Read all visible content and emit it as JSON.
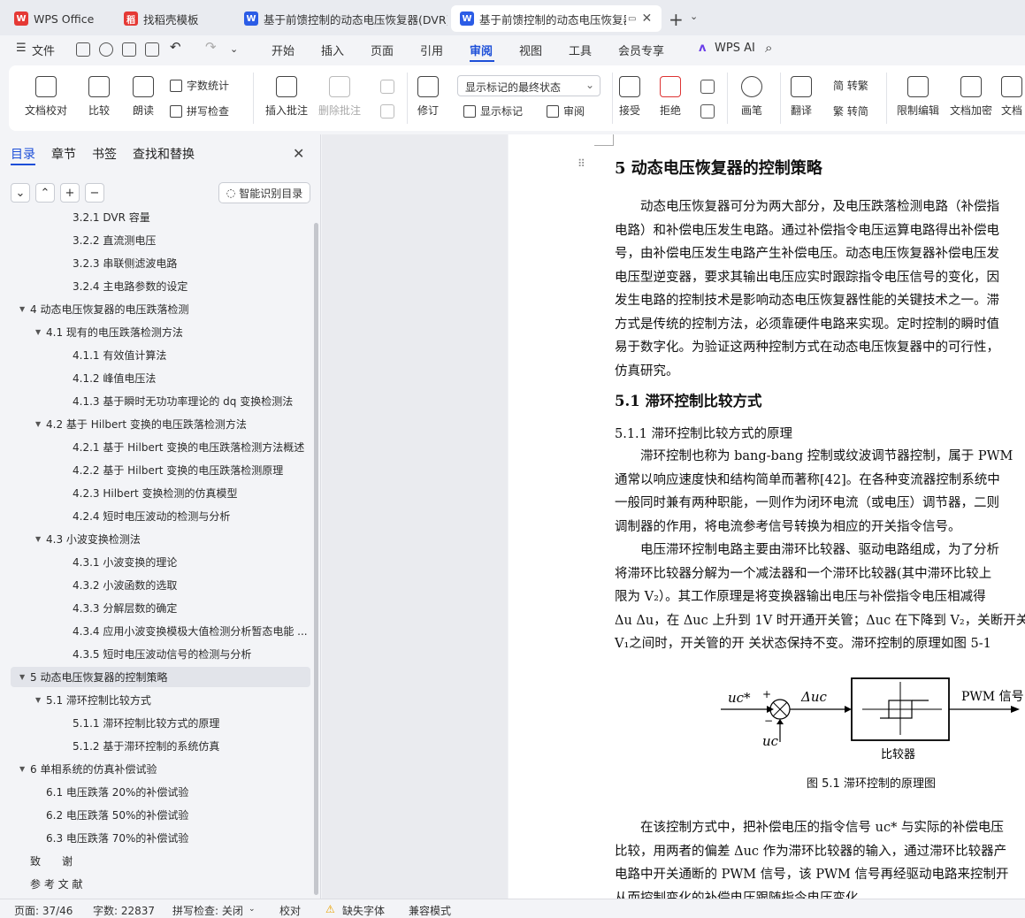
{
  "tabs": [
    {
      "label": "WPS Office",
      "icon": "wps-logo-icon",
      "color": "#e53935"
    },
    {
      "label": "找稻壳模板",
      "icon": "docer-icon",
      "color": "#e53935"
    },
    {
      "label": "基于前馈控制的动态电压恢复器(DVR)",
      "icon": "word-doc-icon",
      "color": "#2b5ce6"
    },
    {
      "label": "基于前馈控制的动态电压恢复器",
      "icon": "word-doc-icon",
      "color": "#2b5ce6"
    }
  ],
  "menu": {
    "file": "文件",
    "items": [
      "开始",
      "插入",
      "页面",
      "引用",
      "审阅",
      "视图",
      "工具",
      "会员专享"
    ],
    "active": "审阅",
    "wps_ai": "WPS AI"
  },
  "ribbon": {
    "doc_check": "文档校对",
    "compare": "比较",
    "read_aloud": "朗读",
    "word_count": "字数统计",
    "spell_check": "拼写检查",
    "insert_comment": "插入批注",
    "delete_comment": "删除批注",
    "track": "修订",
    "display_state": "显示标记的最终状态",
    "show_markup": "显示标记",
    "review": "审阅",
    "accept": "接受",
    "reject": "拒绝",
    "pen": "画笔",
    "translate": "翻译",
    "to_trad": "简 转繁",
    "to_simp": "繁 转简",
    "restrict_edit": "限制编辑",
    "encrypt": "文档加密",
    "doc_more": "文档"
  },
  "nav": {
    "tabs": [
      "目录",
      "章节",
      "书签",
      "查找和替换"
    ],
    "active_tab": "目录",
    "smart_toc": "智能识别目录",
    "items": [
      {
        "text": "3.2.1 DVR 容量",
        "level": 3,
        "arrow": ""
      },
      {
        "text": "3.2.2 直流测电压",
        "level": 3,
        "arrow": ""
      },
      {
        "text": "3.2.3 串联侧滤波电路",
        "level": 3,
        "arrow": ""
      },
      {
        "text": "3.2.4 主电路参数的设定",
        "level": 3,
        "arrow": ""
      },
      {
        "text": "4 动态电压恢复器的电压跌落检测",
        "level": 1,
        "arrow": "▼"
      },
      {
        "text": "4.1 现有的电压跌落检测方法",
        "level": 2,
        "arrow": "▼"
      },
      {
        "text": "4.1.1 有效值计算法",
        "level": 3,
        "arrow": ""
      },
      {
        "text": "4.1.2 峰值电压法",
        "level": 3,
        "arrow": ""
      },
      {
        "text": "4.1.3 基于瞬时无功功率理论的 dq 变换检测法",
        "level": 3,
        "arrow": ""
      },
      {
        "text": "4.2 基于 Hilbert 变换的电压跌落检测方法",
        "level": 2,
        "arrow": "▼"
      },
      {
        "text": "4.2.1 基于 Hilbert 变换的电压跌落检测方法概述",
        "level": 3,
        "arrow": ""
      },
      {
        "text": "4.2.2 基于 Hilbert 变换的电压跌落检测原理",
        "level": 3,
        "arrow": ""
      },
      {
        "text": "4.2.3 Hilbert 变换检测的仿真模型",
        "level": 3,
        "arrow": ""
      },
      {
        "text": "4.2.4 短时电压波动的检测与分析",
        "level": 3,
        "arrow": ""
      },
      {
        "text": "4.3 小波变换检测法",
        "level": 2,
        "arrow": "▼"
      },
      {
        "text": "4.3.1 小波变换的理论",
        "level": 3,
        "arrow": ""
      },
      {
        "text": "4.3.2 小波函数的选取",
        "level": 3,
        "arrow": ""
      },
      {
        "text": "4.3.3 分解层数的确定",
        "level": 3,
        "arrow": ""
      },
      {
        "text": "4.3.4 应用小波变换模极大值检测分析暂态电能 ...",
        "level": 3,
        "arrow": ""
      },
      {
        "text": "4.3.5 短时电压波动信号的检测与分析",
        "level": 3,
        "arrow": ""
      },
      {
        "text": "5 动态电压恢复器的控制策略",
        "level": 1,
        "arrow": "▼",
        "selected": true
      },
      {
        "text": "5.1 滞环控制比较方式",
        "level": 2,
        "arrow": "▼"
      },
      {
        "text": "5.1.1 滞环控制比较方式的原理",
        "level": 3,
        "arrow": ""
      },
      {
        "text": "5.1.2 基于滞环控制的系统仿真",
        "level": 3,
        "arrow": ""
      },
      {
        "text": "6 单相系统的仿真补偿试验",
        "level": 1,
        "arrow": "▼"
      },
      {
        "text": "6.1 电压跌落 20%的补偿试验",
        "level": 2,
        "arrow": ""
      },
      {
        "text": "6.2 电压跌落 50%的补偿试验",
        "level": 2,
        "arrow": ""
      },
      {
        "text": "6.3 电压跌落 70%的补偿试验",
        "level": 2,
        "arrow": ""
      },
      {
        "text": "致　　谢",
        "level": 1,
        "arrow": ""
      },
      {
        "text": "参 考 文 献",
        "level": 1,
        "arrow": ""
      }
    ]
  },
  "doc": {
    "heading": "5 动态电压恢复器的控制策略",
    "para1": [
      "　　动态电压恢复器可分为两大部分，及电压跌落检测电路（补偿指",
      "电路）和补偿电压发生电路。通过补偿指令电压运算电路得出补偿电",
      "号，由补偿电压发生电路产生补偿电压。动态电压恢复器补偿电压发",
      "电压型逆变器，要求其输出电压应实时跟踪指令电压信号的变化，因",
      "发生电路的控制技术是影响动态电压恢复器性能的关键技术之一。滞",
      "方式是传统的控制方法，必须靠硬件电路来实现。定时控制的瞬时值",
      "易于数字化。为验证这两种控制方式在动态电压恢复器中的可行性，",
      "仿真研究。"
    ],
    "h2": "5.1  滞环控制比较方式",
    "h3": "5.1.1  滞环控制比较方式的原理",
    "para2": [
      "　　滞环控制也称为 bang-bang 控制或纹波调节器控制，属于 PWM",
      "通常以响应速度快和结构简单而著称[42]。在各种变流器控制系统中",
      "一般同时兼有两种职能，一则作为闭环电流（或电压）调节器，二则",
      "调制器的作用，将电流参考信号转换为相应的开关指令信号。",
      "　　电压滞环控制电路主要由滞环比较器、驱动电路组成，为了分析",
      "将滞环比较器分解为一个减法器和一个滞环比较器(其中滞环比较上",
      "限为 V₂）。其工作原理是将变换器输出电压与补偿指令电压相减得",
      "Δu Δu，在 Δuc 上升到 1V 时开通开关管；Δuc 在下降到 V₂，关断开关",
      "V₁之间时，开关管的开  关状态保持不变。滞环控制的原理如图 5-1"
    ],
    "figure": {
      "input_ref": "uc*",
      "plus": "+",
      "minus": "−",
      "feedback": "uc",
      "error": "Δuc",
      "output": "PWM 信号",
      "block_label": "比较器",
      "caption": "图 5.1 滞环控制的原理图"
    },
    "para3": [
      "　　在该控制方式中，把补偿电压的指令信号 uc* 与实际的补偿电压",
      "比较，用两者的偏差 Δuc 作为滞环比较器的输入，通过滞环比较器产",
      "电路中开关通断的 PWM 信号，该 PWM 信号再经驱动电路来控制开",
      "从而控制变化的补偿电压跟随指令电压变化"
    ]
  },
  "status": {
    "page": "页面: 37/46",
    "words": "字数: 22837",
    "spell": "拼写检查: 关闭",
    "proof": "校对",
    "missing_font": "缺失字体",
    "compat": "兼容模式"
  }
}
